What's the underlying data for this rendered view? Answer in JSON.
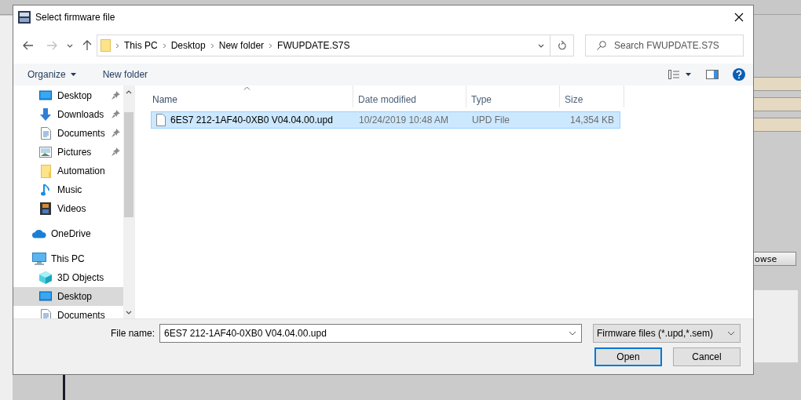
{
  "window": {
    "title": "Select firmware file"
  },
  "nav_buttons": [
    {
      "kind": "back",
      "disabled": false
    },
    {
      "kind": "forward",
      "disabled": true
    },
    {
      "kind": "recent",
      "disabled": false
    },
    {
      "kind": "up",
      "disabled": false
    }
  ],
  "address": {
    "crumbs": [
      "This PC",
      "Desktop",
      "New folder",
      "FWUPDATE.S7S"
    ]
  },
  "search": {
    "placeholder": "Search FWUPDATE.S7S"
  },
  "toolbar": {
    "buttons": [
      {
        "label": "Organize",
        "dropdown": true
      },
      {
        "label": "New folder",
        "dropdown": false
      }
    ]
  },
  "sidebar": {
    "quick_items": [
      {
        "label": "Desktop",
        "kind": "desktop",
        "pinned": true,
        "selected": false
      },
      {
        "label": "Downloads",
        "kind": "downloads",
        "pinned": true,
        "selected": false
      },
      {
        "label": "Documents",
        "kind": "documents",
        "pinned": true,
        "selected": false
      },
      {
        "label": "Pictures",
        "kind": "pictures",
        "pinned": true,
        "selected": false
      },
      {
        "label": "Automation",
        "kind": "folder",
        "pinned": false,
        "selected": false
      },
      {
        "label": "Music",
        "kind": "music",
        "pinned": false,
        "selected": false
      },
      {
        "label": "Videos",
        "kind": "videos",
        "pinned": false,
        "selected": false
      }
    ],
    "roots": [
      {
        "label": "OneDrive",
        "kind": "onedrive",
        "selected": false
      },
      {
        "label": "This PC",
        "kind": "pc",
        "selected": false,
        "children": [
          {
            "label": "3D Objects",
            "kind": "objects3d",
            "selected": false
          },
          {
            "label": "Desktop",
            "kind": "desktop",
            "selected": true
          },
          {
            "label": "Documents",
            "kind": "documents",
            "selected": false
          }
        ]
      }
    ]
  },
  "table": {
    "columns": [
      {
        "label": "Name",
        "sorted": true
      },
      {
        "label": "Date modified",
        "sorted": false
      },
      {
        "label": "Type",
        "sorted": false
      },
      {
        "label": "Size",
        "sorted": false
      }
    ],
    "rows": [
      {
        "name": "6ES7 212-1AF40-0XB0 V04.04.00.upd",
        "date": "10/24/2019 10:48 AM",
        "type": "UPD File",
        "size": "14,354 KB",
        "selected": true
      }
    ]
  },
  "file_name": {
    "label": "File name:",
    "value": "6ES7 212-1AF40-0XB0 V04.04.00.upd"
  },
  "filter": {
    "value": "Firmware files (*.upd,*.sem)"
  },
  "buttons": [
    {
      "label": "Open",
      "default": true
    },
    {
      "label": "Cancel",
      "default": false
    }
  ],
  "background": {
    "button_text": "owse"
  }
}
